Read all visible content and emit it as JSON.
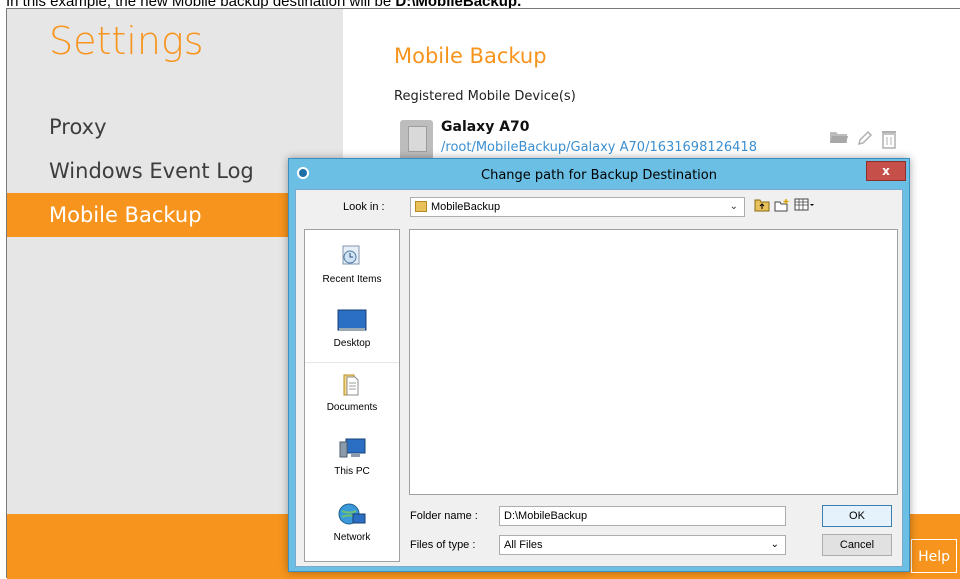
{
  "caption": {
    "text_prefix": "In this example, the new Mobile backup destination will be ",
    "text_bold": "D:\\MobileBackup."
  },
  "sidebar": {
    "title": "Settings",
    "items": [
      {
        "label": "Proxy",
        "active": false
      },
      {
        "label": "Windows Event Log",
        "active": false
      },
      {
        "label": "Mobile Backup",
        "active": true
      }
    ]
  },
  "main": {
    "title": "Mobile Backup",
    "registered_label": "Registered Mobile Device(s)",
    "device": {
      "name": "Galaxy A70",
      "path": "/root/MobileBackup/Galaxy A70/1631698126418"
    }
  },
  "footer": {
    "help_label": "Help"
  },
  "dialog": {
    "title": "Change path for Backup Destination",
    "close_label": "x",
    "look_in_label": "Look in :",
    "look_in_value": "MobileBackup",
    "places": [
      {
        "label": "Recent Items",
        "icon": "recent-items-icon"
      },
      {
        "label": "Desktop",
        "icon": "desktop-icon"
      },
      {
        "label": "Documents",
        "icon": "documents-icon"
      },
      {
        "label": "This PC",
        "icon": "this-pc-icon"
      },
      {
        "label": "Network",
        "icon": "network-icon"
      }
    ],
    "folder_name_label": "Folder name :",
    "folder_name_value": "D:\\MobileBackup",
    "files_of_type_label": "Files of type :",
    "files_of_type_value": "All Files",
    "ok_label": "OK",
    "cancel_label": "Cancel"
  },
  "colors": {
    "accent": "#f7941d",
    "dialog_border": "#6bbfe4",
    "link": "#3b8fd1"
  }
}
